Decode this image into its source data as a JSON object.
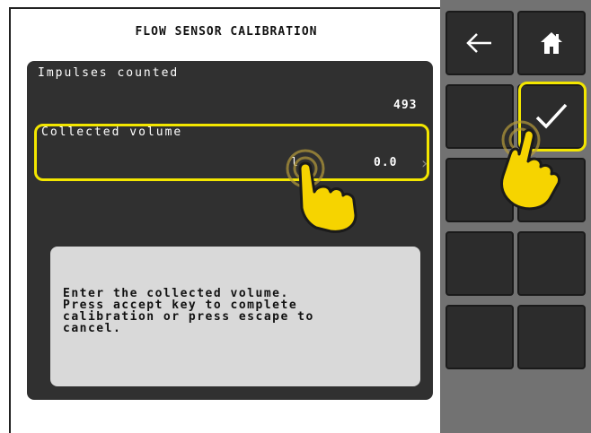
{
  "screen": {
    "title": "FLOW SENSOR CALIBRATION",
    "impulses": {
      "label": "Impulses counted",
      "value": "493"
    },
    "volume": {
      "label": "Collected volume",
      "unit": "l",
      "value": "0.0"
    },
    "message": "Enter the collected volume.\nPress accept key to complete\ncalibration or press escape to\ncancel."
  },
  "softkeys": [
    {
      "name": "back-arrow-icon"
    },
    {
      "name": "home-icon"
    },
    {
      "name": "empty"
    },
    {
      "name": "accept-checkmark-icon"
    },
    {
      "name": "empty"
    },
    {
      "name": "empty"
    },
    {
      "name": "empty"
    },
    {
      "name": "empty"
    },
    {
      "name": "empty"
    },
    {
      "name": "empty"
    }
  ],
  "colors": {
    "highlight": "#f3e600",
    "panel": "#303030",
    "keypad_bg": "#727272"
  }
}
